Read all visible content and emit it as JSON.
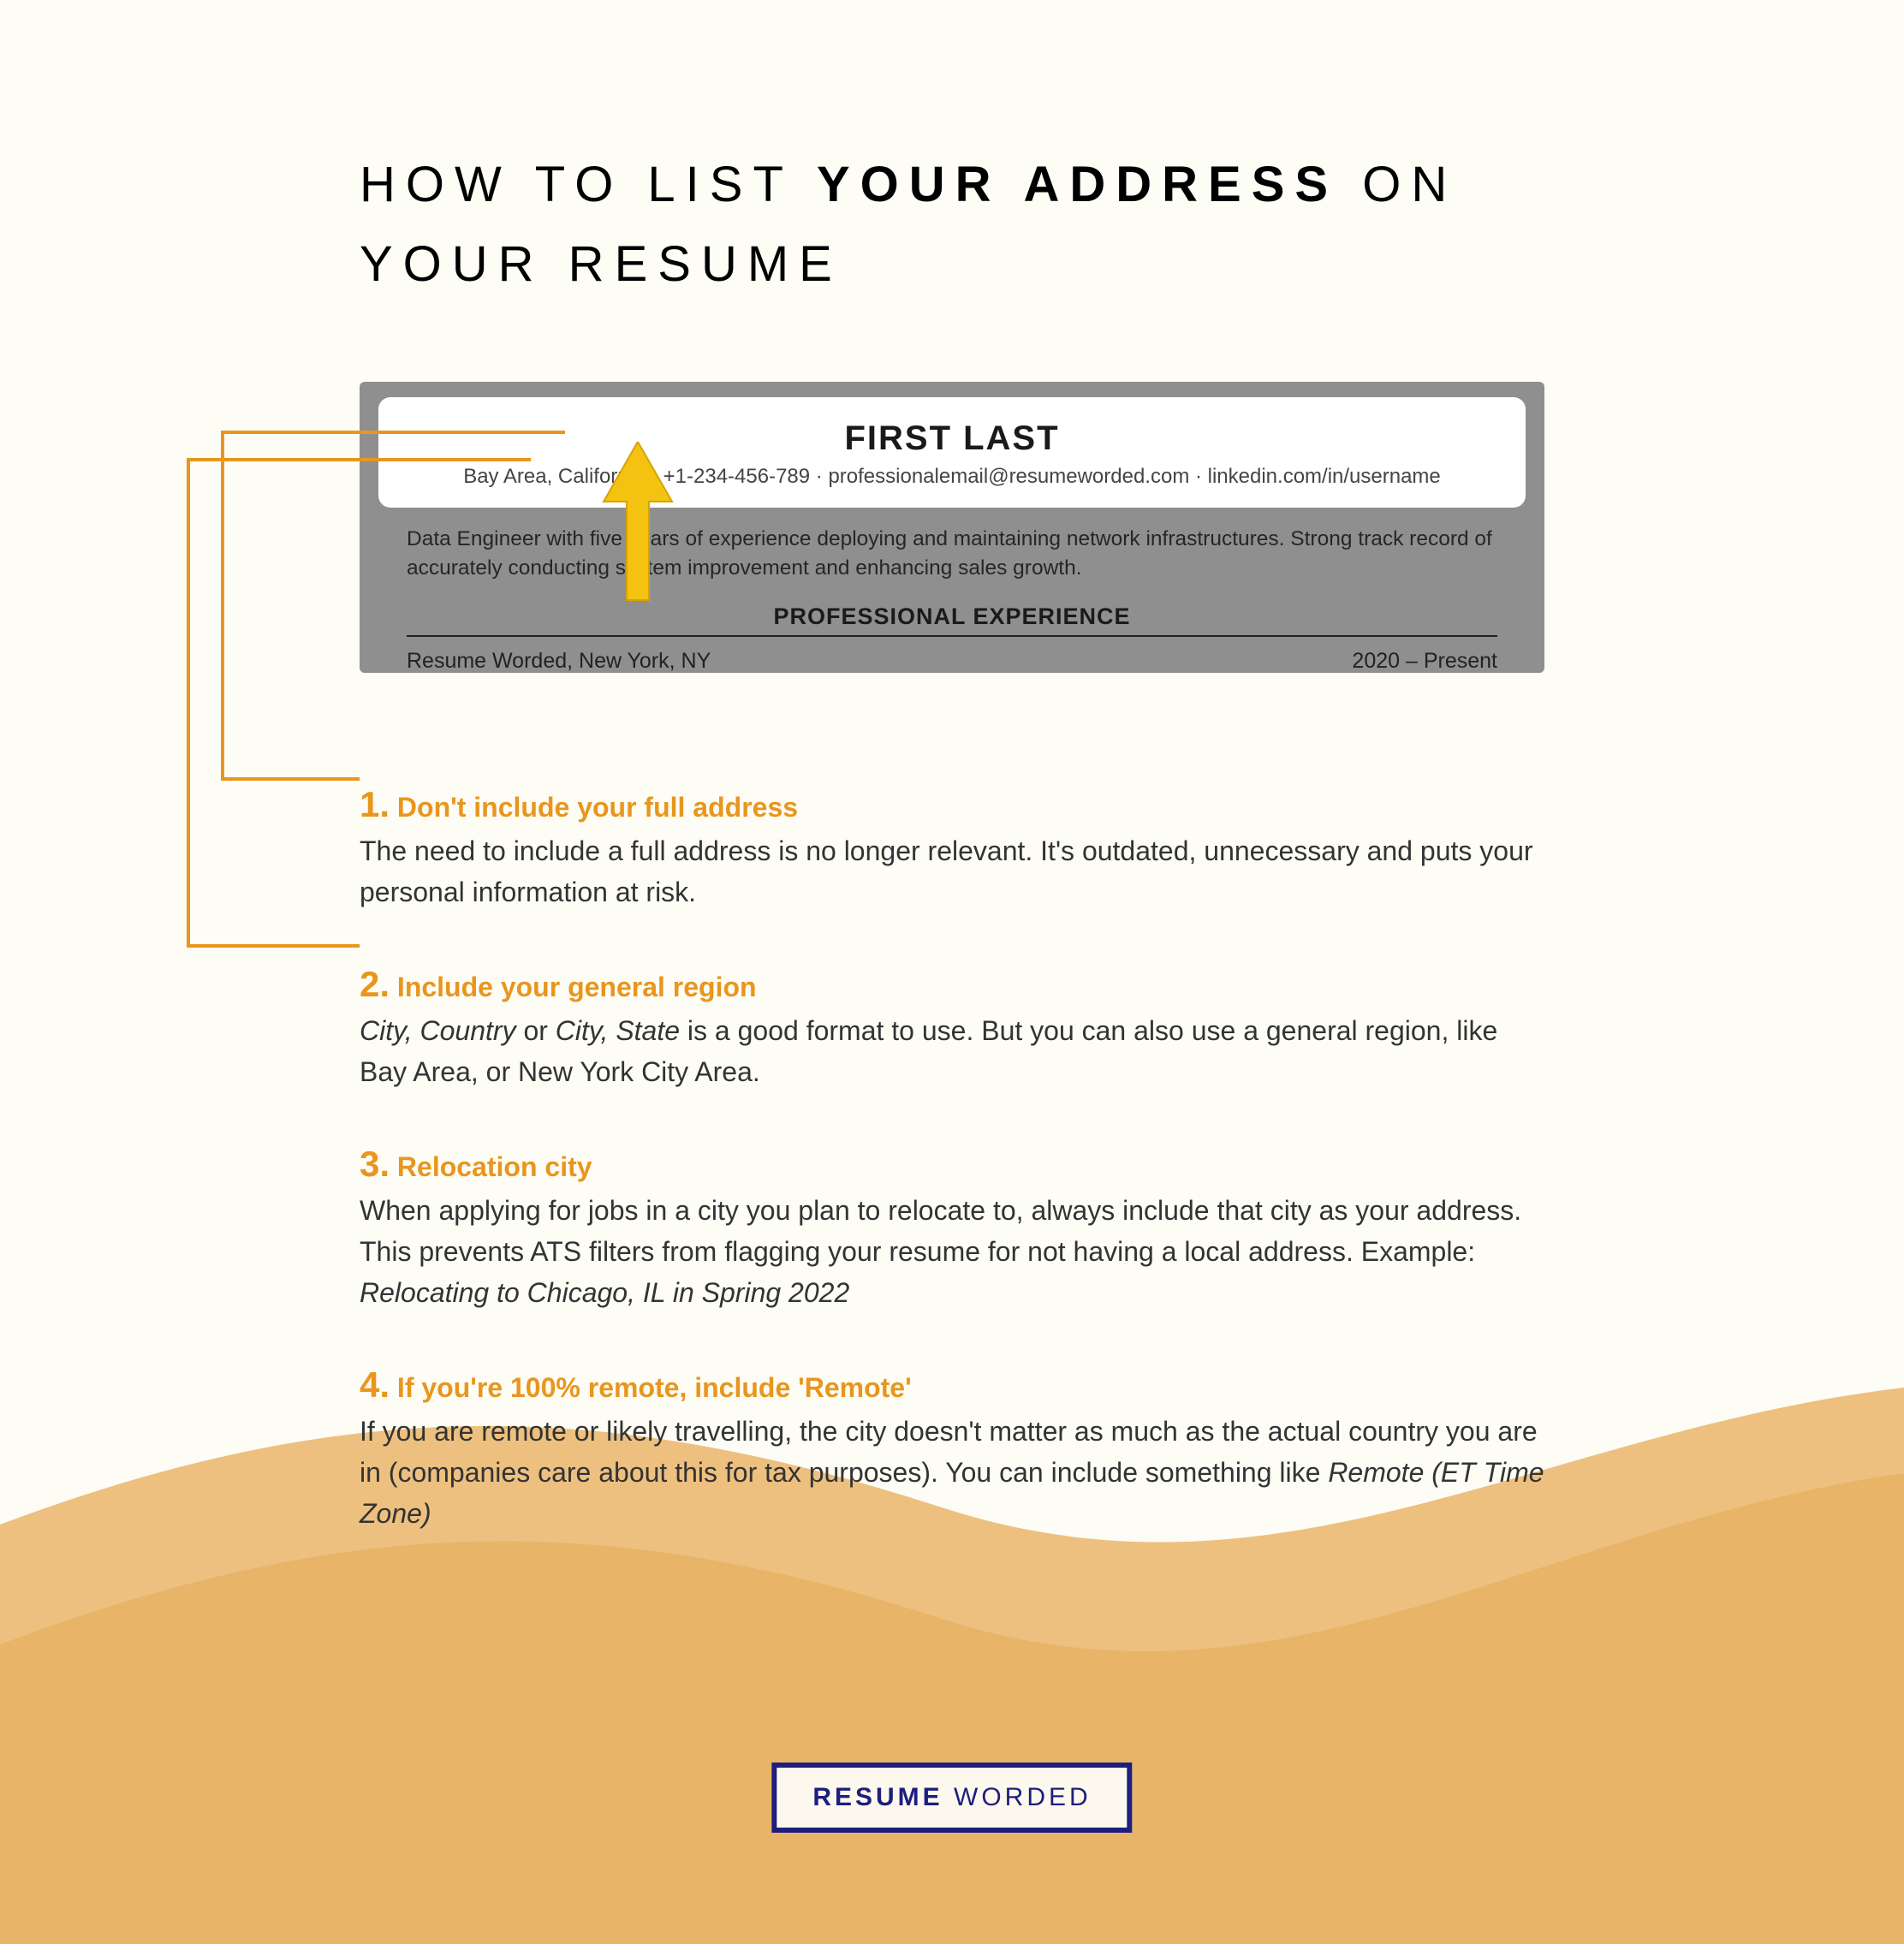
{
  "title": {
    "pre": "HOW TO LIST ",
    "bold": "YOUR ADDRESS",
    "post": " ON YOUR RESUME"
  },
  "resume": {
    "name": "FIRST LAST",
    "contact": "Bay Area, California · +1-234-456-789 · professionalemail@resumeworded.com · linkedin.com/in/username",
    "summary": "Data Engineer with five years of experience deploying and maintaining network infrastructures. Strong track record of accurately conducting system improvement and enhancing sales growth.",
    "section_heading": "PROFESSIONAL EXPERIENCE",
    "job_left": "Resume Worded, New York, NY",
    "job_right": "2020 – Present"
  },
  "tips": [
    {
      "num": "1.",
      "heading": "Don't include your full address",
      "body_plain": "The need to include a full address is no longer relevant. It's outdated, unnecessary and puts your personal information at risk."
    },
    {
      "num": "2.",
      "heading": "Include your general region",
      "body_html": "<span class='ital'>City, Country</span> or <span class='ital'>City, State</span>  is a good format to use. But you can also use a general region, like Bay Area, or New York City Area."
    },
    {
      "num": "3.",
      "heading": "Relocation city",
      "body_html": "When applying for jobs in a city you plan to relocate to, always include that city as your address. This prevents ATS filters from flagging your resume for not having a local address. Example: <span class='ital'>Relocating to Chicago, IL in Spring 2022</span>"
    },
    {
      "num": "4.",
      "heading": "If you're 100% remote, include 'Remote'",
      "body_html": "If you are remote or likely travelling, the city doesn't matter as much as the actual country you are in (companies care about this for tax purposes). You can include something like <span class='ital'>Remote (ET Time Zone)</span>"
    }
  ],
  "logo": {
    "bold": "RESUME",
    "rest": " WORDED"
  }
}
